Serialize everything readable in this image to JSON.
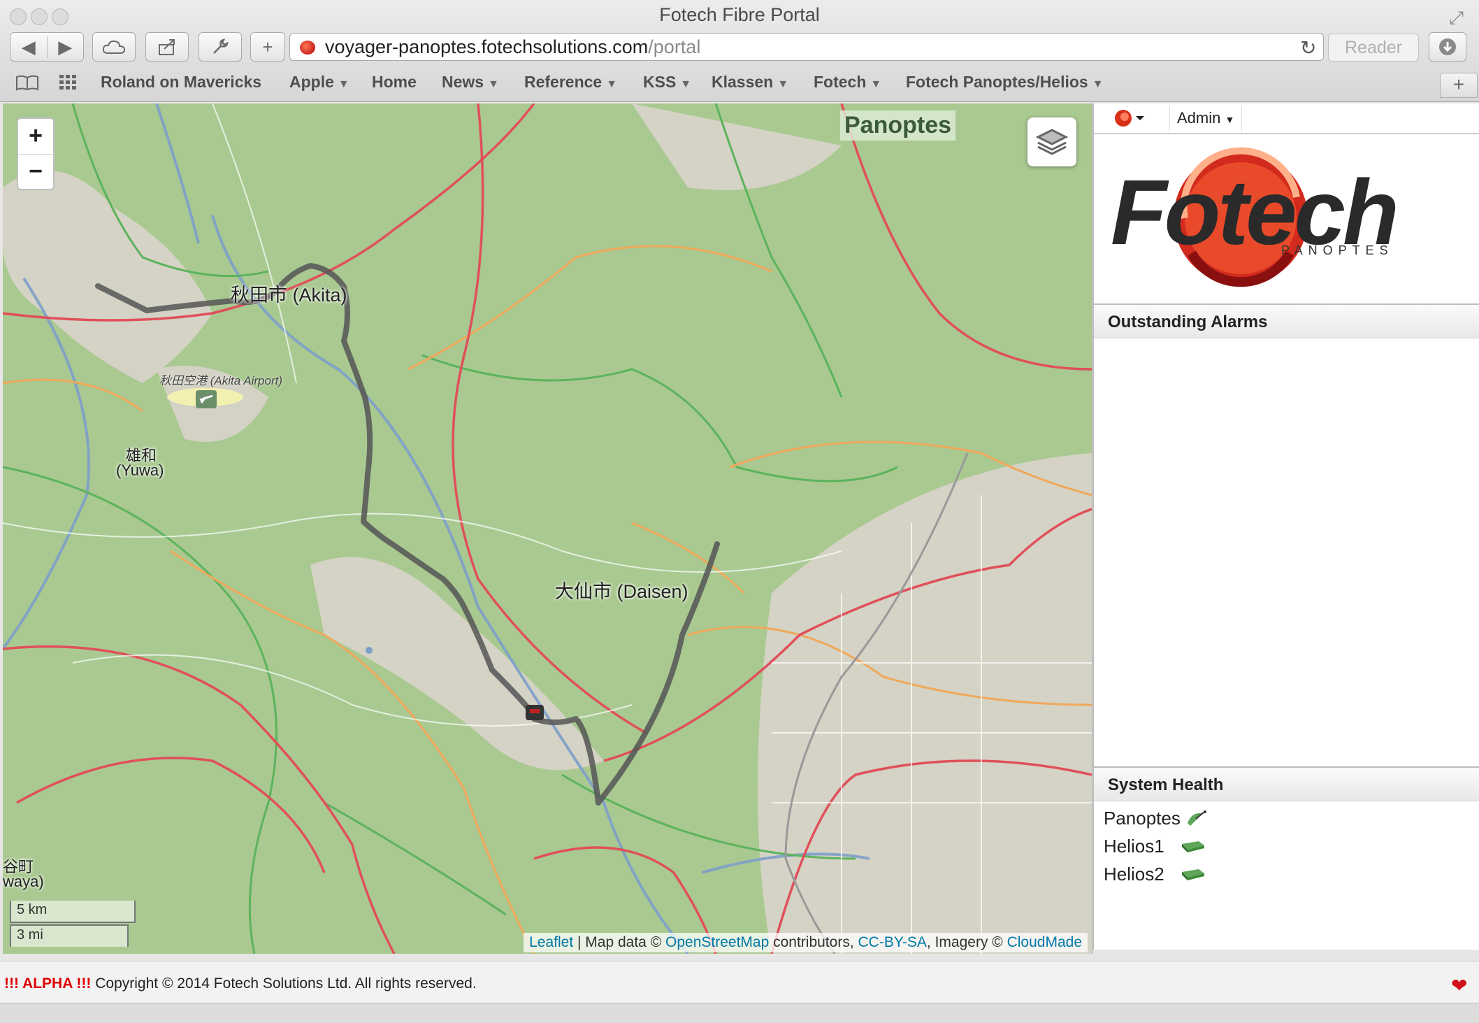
{
  "window": {
    "title": "Fotech Fibre Portal"
  },
  "toolbar": {
    "url_host": "voyager-panoptes.fotechsolutions.com",
    "url_path": "/portal",
    "reader_label": "Reader"
  },
  "bookmarks": [
    {
      "label": "Roland on Mavericks",
      "menu": false
    },
    {
      "label": "Apple",
      "menu": true
    },
    {
      "label": "Home",
      "menu": false
    },
    {
      "label": "News",
      "menu": true
    },
    {
      "label": "Reference",
      "menu": true
    },
    {
      "label": "KSS",
      "menu": true
    },
    {
      "label": "Klassen",
      "menu": true
    },
    {
      "label": "Fotech",
      "menu": true
    },
    {
      "label": "Fotech Panoptes/Helios",
      "menu": true
    }
  ],
  "map": {
    "zoom_in": "+",
    "zoom_out": "−",
    "system_label": "Panoptes",
    "places": {
      "akita": "秋田市 (Akita)",
      "akita_airport": "秋田空港 (Akita Airport)",
      "yuwa_jp": "雄和",
      "yuwa_en": "(Yuwa)",
      "daisen": "大仙市 (Daisen)",
      "edge_jp": "谷町",
      "edge_en": "waya)"
    },
    "scale_km": "5 km",
    "scale_mi": "3 mi",
    "attribution": {
      "leaflet": "Leaflet",
      "sep1": " | Map data © ",
      "osm": "OpenStreetMap",
      "sep2": " contributors, ",
      "license": "CC-BY-SA",
      "sep3": ", Imagery © ",
      "imagery": "CloudMade"
    }
  },
  "sidebar": {
    "user_menu": "Admin",
    "logo_word": "Fotech",
    "logo_sub": "PANOPTES",
    "alarms_title": "Outstanding Alarms",
    "health_title": "System Health",
    "health_items": [
      {
        "name": "Panoptes",
        "icon": "satellite-dish-icon"
      },
      {
        "name": "Helios1",
        "icon": "server-icon"
      },
      {
        "name": "Helios2",
        "icon": "server-icon"
      }
    ]
  },
  "footer": {
    "alpha": "!!! ALPHA !!!",
    "copyright": " Copyright © 2014 Fotech Solutions Ltd. All rights reserved."
  },
  "colors": {
    "accent": "#d0101a",
    "map_green": "#a9c991",
    "fibre": "#555555"
  }
}
